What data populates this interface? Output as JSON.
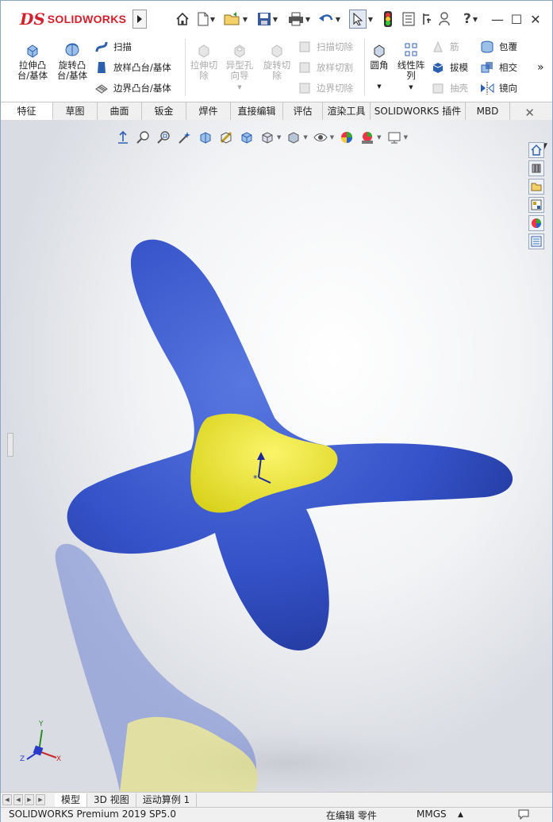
{
  "app": {
    "logo_ds": "DS",
    "logo_text": "SOLIDWORKS"
  },
  "quick_access": [
    {
      "name": "home-icon",
      "glyph": "⌂"
    },
    {
      "name": "new-document-icon",
      "glyph": "🗋"
    },
    {
      "name": "open-icon",
      "glyph": "📂"
    },
    {
      "name": "save-icon",
      "glyph": "💾"
    },
    {
      "name": "print-icon",
      "glyph": "🖶"
    },
    {
      "name": "undo-icon",
      "glyph": "↶"
    },
    {
      "name": "select-icon",
      "glyph": "⬉"
    },
    {
      "name": "rebuild-icon",
      "glyph": "🚦"
    },
    {
      "name": "file-properties-icon",
      "glyph": "▤"
    },
    {
      "name": "options-icon",
      "glyph": "⚙"
    },
    {
      "name": "user-icon",
      "glyph": "👤"
    },
    {
      "name": "help-icon",
      "glyph": "?"
    }
  ],
  "window_controls": {
    "minimize": "—",
    "maximize": "☐",
    "close": "✕"
  },
  "command_manager": {
    "extrude_boss": "拉伸凸\n台/基体",
    "revolve_boss": "旋转凸\n台/基体",
    "sweep": "扫描",
    "loft_boss": "放样凸台/基体",
    "boundary_boss": "边界凸台/基体",
    "extrude_cut": "拉伸切\n除",
    "hole_wizard": "异型孔\n向导",
    "revolve_cut": "旋转切\n除",
    "swept_cut": "扫描切除",
    "lofted_cut": "放样切割",
    "boundary_cut": "边界切除",
    "fillet": "圆角",
    "linear_pattern": "线性阵\n列",
    "rib": "筋",
    "draft": "拔模",
    "shell": "抽壳",
    "wrap": "包覆",
    "intersect": "相交",
    "mirror": "镜向",
    "overflow": "»"
  },
  "tabs": [
    "特征",
    "草图",
    "曲面",
    "钣金",
    "焊件",
    "直接编辑",
    "评估",
    "渲染工具",
    "SOLIDWORKS 插件",
    "MBD"
  ],
  "active_tab": "特征",
  "bottom_tabs": [
    "模型",
    "3D 视图",
    "运动算例 1"
  ],
  "active_bottom_tab": "模型",
  "status": {
    "product": "SOLIDWORKS Premium 2019 SP5.0",
    "mode": "在编辑 零件",
    "units": "MMGS"
  },
  "colors": {
    "accent_red": "#d21f2b",
    "part_blue": "#3552c8",
    "part_yellow": "#f2ea2e"
  },
  "triad": {
    "x": "X",
    "y": "Y",
    "z": "Z"
  }
}
